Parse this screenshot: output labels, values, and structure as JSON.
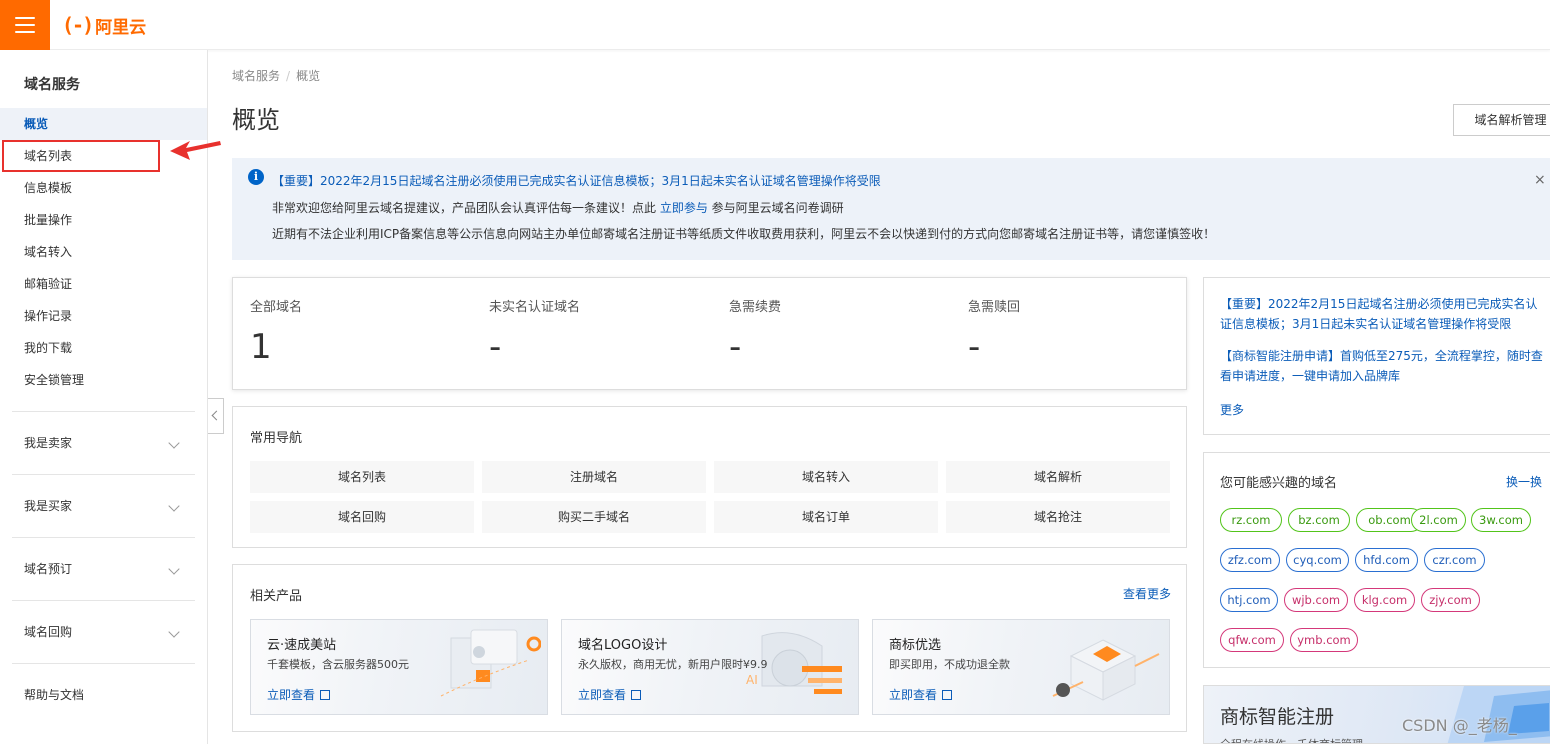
{
  "brand": {
    "logo_mark": "(-)",
    "logo_text": "阿里云"
  },
  "sidebar": {
    "title": "域名服务",
    "items": [
      {
        "label": "概览",
        "active": true
      },
      {
        "label": "域名列表",
        "active": false
      },
      {
        "label": "信息模板",
        "active": false
      },
      {
        "label": "批量操作",
        "active": false
      },
      {
        "label": "域名转入",
        "active": false
      },
      {
        "label": "邮箱验证",
        "active": false
      },
      {
        "label": "操作记录",
        "active": false
      },
      {
        "label": "我的下载",
        "active": false
      },
      {
        "label": "安全锁管理",
        "active": false
      }
    ],
    "groups": [
      {
        "label": "我是卖家"
      },
      {
        "label": "我是买家"
      },
      {
        "label": "域名预订"
      },
      {
        "label": "域名回购"
      }
    ],
    "help": "帮助与文档"
  },
  "breadcrumb": {
    "root": "域名服务",
    "separator": "/",
    "current": "概览"
  },
  "page_title": "概览",
  "dns_button": "域名解析管理",
  "notice": {
    "line1": "【重要】2022年2月15日起域名注册必须使用已完成实名认证信息模板；3月1日起未实名认证域名管理操作将受限",
    "line2_prefix": "非常欢迎您给阿里云域名提建议，产品团队会认真评估每一条建议！点此 ",
    "line2_link": "立即参与",
    "line2_suffix": " 参与阿里云域名问卷调研",
    "line3": "近期有不法企业利用ICP备案信息等公示信息向网站主办单位邮寄域名注册证书等纸质文件收取费用获利，阿里云不会以快递到付的方式向您邮寄域名注册证书等，请您谨慎签收！",
    "close": "×"
  },
  "stats": [
    {
      "label": "全部域名",
      "value": "1"
    },
    {
      "label": "未实名认证域名",
      "value": "-"
    },
    {
      "label": "急需续费",
      "value": "-"
    },
    {
      "label": "急需赎回",
      "value": "-"
    }
  ],
  "common_nav": {
    "title": "常用导航",
    "items": [
      "域名列表",
      "注册域名",
      "域名转入",
      "域名解析",
      "域名回购",
      "购买二手域名",
      "域名订单",
      "域名抢注"
    ]
  },
  "related_products": {
    "title": "相关产品",
    "more": "查看更多",
    "items": [
      {
        "title": "云·速成美站",
        "desc": "千套模板，含云服务器500元",
        "link": "立即查看"
      },
      {
        "title": "域名LOGO设计",
        "desc": "永久版权，商用无忧，新用户限时¥9.9",
        "link": "立即查看"
      },
      {
        "title": "商标优选",
        "desc": "即买即用，不成功退全款",
        "link": "立即查看"
      }
    ]
  },
  "news": {
    "items": [
      "【重要】2022年2月15日起域名注册必须使用已完成实名认证信息模板；3月1日起未实名认证域名管理操作将受限",
      "【商标智能注册申请】首购低至275元，全流程掌控，随时查看申请进度，一键申请加入品牌库"
    ],
    "more": "更多"
  },
  "suggested_domains": {
    "title": "您可能感兴趣的域名",
    "swap": "换一换",
    "tags": [
      {
        "name": "rz.com",
        "color": "green"
      },
      {
        "name": "bz.com",
        "color": "green"
      },
      {
        "name": "ob.com",
        "color": "green"
      },
      {
        "name": "2l.com",
        "color": "green"
      },
      {
        "name": "3w.com",
        "color": "green"
      },
      {
        "name": "zfz.com",
        "color": "blue"
      },
      {
        "name": "cyq.com",
        "color": "blue"
      },
      {
        "name": "hfd.com",
        "color": "blue"
      },
      {
        "name": "czr.com",
        "color": "blue"
      },
      {
        "name": "htj.com",
        "color": "blue"
      },
      {
        "name": "wjb.com",
        "color": "red"
      },
      {
        "name": "klg.com",
        "color": "red"
      },
      {
        "name": "zjy.com",
        "color": "red"
      },
      {
        "name": "qfw.com",
        "color": "red"
      },
      {
        "name": "ymb.com",
        "color": "red"
      }
    ]
  },
  "banner": {
    "title": "商标智能注册",
    "subtitle": "全程在线操作，千体商标管理"
  },
  "watermark": "CSDN @_老杨_",
  "colors": {
    "brand_orange": "#ff6a00",
    "link_blue": "#0b5cb8",
    "highlight_red": "#e8312d",
    "notice_bg": "#edf2f9"
  }
}
